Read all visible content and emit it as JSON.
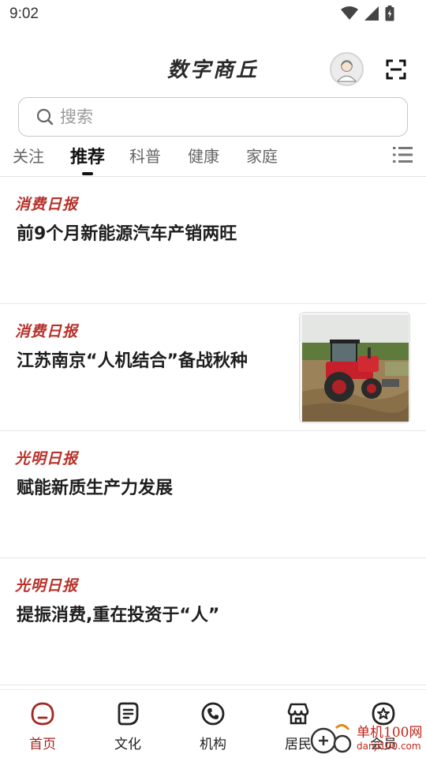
{
  "status_bar": {
    "time": "9:02",
    "icons": [
      "wifi-icon",
      "signal-icon",
      "battery-icon"
    ]
  },
  "header": {
    "title": "数字商丘",
    "avatar_icon": "avatar-icon",
    "scan_icon": "scan-icon"
  },
  "search": {
    "placeholder": "搜索"
  },
  "tabs": [
    {
      "label": "关注",
      "active": false
    },
    {
      "label": "推荐",
      "active": true
    },
    {
      "label": "科普",
      "active": false
    },
    {
      "label": "健康",
      "active": false
    },
    {
      "label": "家庭",
      "active": false
    }
  ],
  "feed": [
    {
      "source": "消费日报",
      "headline": "前9个月新能源汽车产销两旺",
      "has_image": false
    },
    {
      "source": "消费日报",
      "headline": "江苏南京“人机结合”备战秋种",
      "has_image": true,
      "image": "tractor-in-field"
    },
    {
      "source": "光明日报",
      "headline": "赋能新质生产力发展",
      "has_image": false
    },
    {
      "source": "光明日报",
      "headline": "提振消费,重在投资于“人”",
      "has_image": false
    }
  ],
  "bottom_nav": [
    {
      "label": "首页",
      "icon": "home-icon",
      "active": true
    },
    {
      "label": "文化",
      "icon": "document-icon",
      "active": false
    },
    {
      "label": "机构",
      "icon": "phone-icon",
      "active": false
    },
    {
      "label": "居民",
      "icon": "shop-icon",
      "active": false
    },
    {
      "label": "会员",
      "icon": "star-badge-icon",
      "active": false
    }
  ],
  "watermark": {
    "text": "单机100网",
    "sub": "danji100.com"
  },
  "colors": {
    "accent": "#b8312a",
    "active_nav": "#a3261f",
    "text": "#1e1e1e"
  }
}
